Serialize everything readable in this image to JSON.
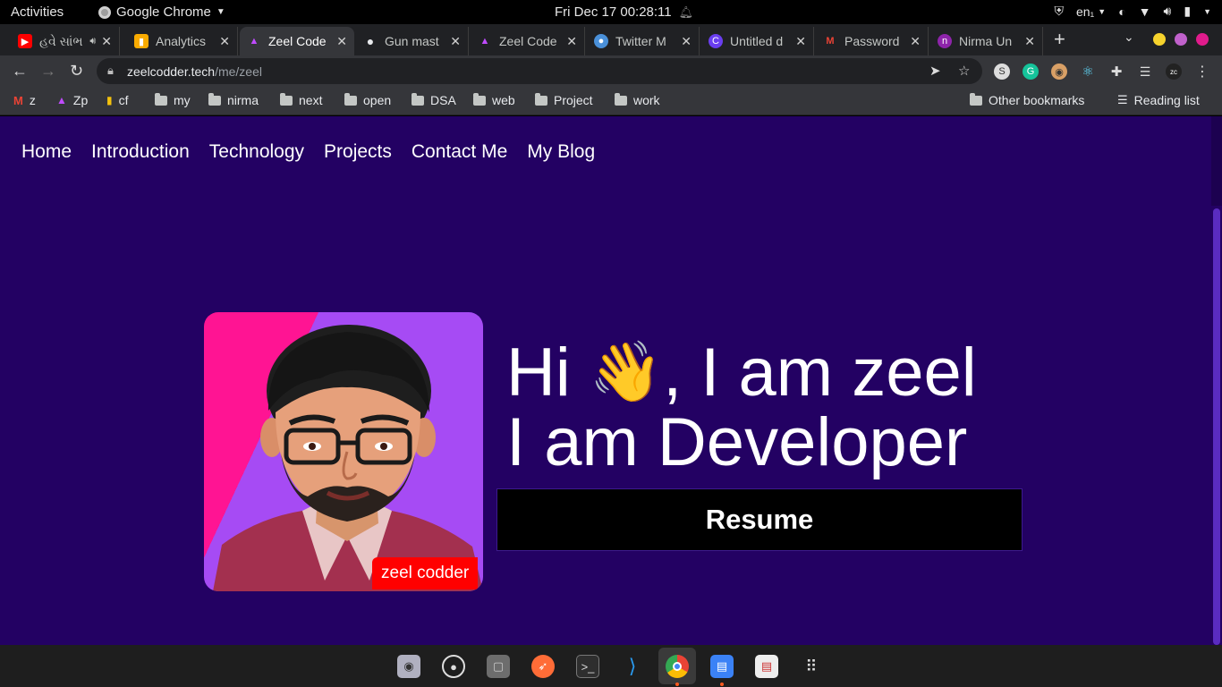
{
  "system_bar": {
    "activities": "Activities",
    "app_name": "Google Chrome",
    "clock": "Fri Dec 17  00:28:11",
    "lang": "en₁"
  },
  "tabs": [
    {
      "label": "હવે સાંભ",
      "favicon": "youtube-icon",
      "color": "#ff0000",
      "active": false
    },
    {
      "label": "Analytics",
      "favicon": "analytics-icon",
      "color": "#f9ab00",
      "active": false
    },
    {
      "label": "Zeel Code",
      "favicon": "zeel-logo-icon",
      "color": "#a020f0",
      "active": true
    },
    {
      "label": "Gun mast",
      "favicon": "globe-icon",
      "color": "#e8eaed",
      "active": false
    },
    {
      "label": "Zeel Code",
      "favicon": "zeel-logo-icon",
      "color": "#a020f0",
      "active": false
    },
    {
      "label": "Twitter M",
      "favicon": "user-icon",
      "color": "#4a90d9",
      "active": false
    },
    {
      "label": "Untitled d",
      "favicon": "canva-icon",
      "color": "#00c4cc",
      "active": false
    },
    {
      "label": "Password",
      "favicon": "gmail-icon",
      "color": "#ea4335",
      "active": false
    },
    {
      "label": "Nirma Un",
      "favicon": "nirma-icon",
      "color": "#8e24aa",
      "active": false
    }
  ],
  "address_bar": {
    "domain": "zeelcodder.tech",
    "path": "/me/zeel"
  },
  "bookmarks": {
    "items": [
      "z",
      "Zp",
      "cf",
      "my",
      "nirma",
      "next",
      "open",
      "DSA",
      "web",
      "Project",
      "work"
    ],
    "other": "Other bookmarks",
    "reading_list": "Reading list"
  },
  "page": {
    "nav": [
      "Home",
      "Introduction",
      "Technology",
      "Projects",
      "Contact Me",
      "My Blog"
    ],
    "avatar_tag": "zeel codder",
    "hero_hi": "Hi ",
    "hero_wave": "👋",
    "hero_rest": ", I am zeel",
    "hero_line2": "I am Developer",
    "resume_button": "Resume"
  },
  "colors": {
    "page_background": "#230163",
    "resume_background": "#000000",
    "avatar_tag": "#ff0000"
  }
}
